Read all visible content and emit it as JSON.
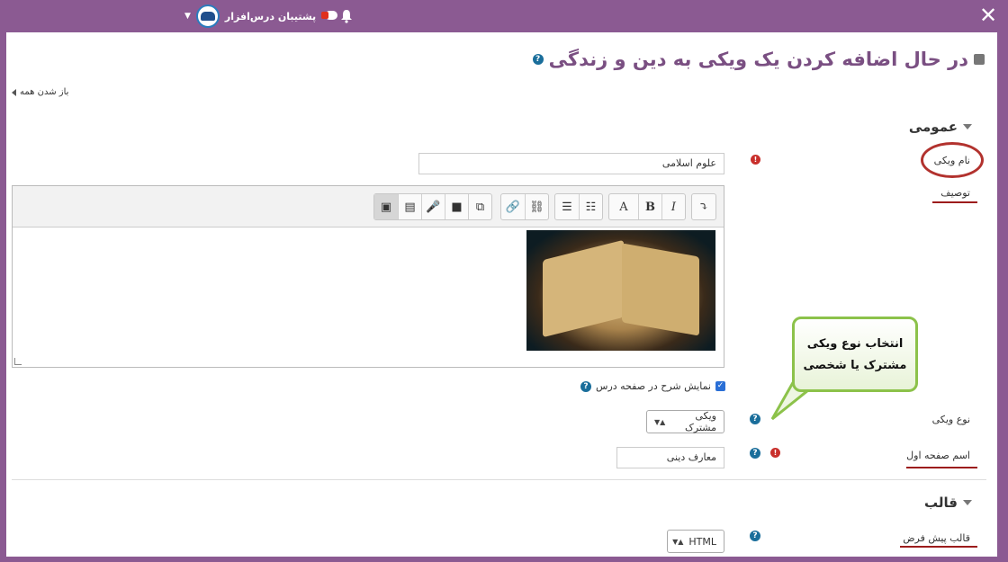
{
  "topbar": {
    "user_name": "پشتیبان درس‌افزار",
    "caret": "▼",
    "close": "✕"
  },
  "page": {
    "title": "در حال اضافه کردن یک ویکی به دین و زندگی",
    "expand_all": "باز شدن همه"
  },
  "section_general": {
    "heading": "عمومی",
    "wiki_name_label": "نام ویکی",
    "wiki_name_value": "علوم اسلامی",
    "description_label": "توصیف",
    "show_desc_label": "نمایش شرح در صفحه درس",
    "wiki_type_label": "نوع ویکی",
    "wiki_type_value": "ویکی مشترک",
    "first_page_label": "اسم صفحه اول",
    "first_page_value": "معارف دینی"
  },
  "section_format": {
    "heading": "قالب",
    "default_format_label": "قالب پیش فرض",
    "default_format_value": "HTML"
  },
  "editor": {
    "toolbar": {
      "toggle": "⤵",
      "font_color": "A",
      "bold": "B",
      "italic": "I",
      "ul": "☰",
      "ol": "☷",
      "link": "🔗",
      "unlink": "⛓",
      "image": "▣",
      "media": "▤",
      "audio": "🎤",
      "video": "■",
      "manage": "⧉"
    }
  },
  "callout": {
    "line1": "انتخاب نوع ویکی",
    "line2": "مشترک یا شخصی"
  },
  "colors": {
    "brand": "#8b5a92",
    "title": "#7a4f82",
    "required": "#c9302c",
    "help": "#1a6e9b",
    "annotation_red": "#b2322e",
    "callout_border": "#8cc24a"
  }
}
